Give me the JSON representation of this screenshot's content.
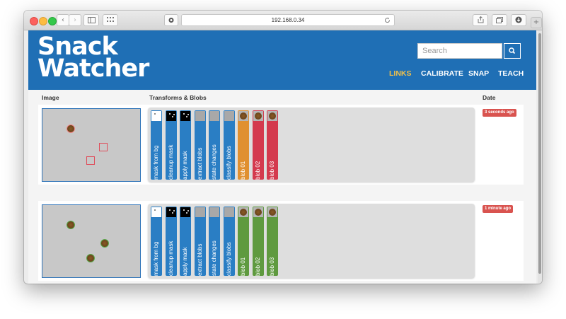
{
  "browser": {
    "url": "192.168.0.34",
    "back_glyph": "‹",
    "forward_glyph": "›"
  },
  "app": {
    "logo_line1": "Snack",
    "logo_line2": "Watcher",
    "search_placeholder": "Search",
    "nav": [
      "LINKS",
      "CALIBRATE",
      "SNAP",
      "TEACH"
    ],
    "active_nav": "LINKS"
  },
  "table": {
    "headers": {
      "image": "Image",
      "transforms": "Transforms & Blobs",
      "date": "Date"
    }
  },
  "rows": [
    {
      "date": "3 seconds ago",
      "strips": [
        {
          "label": "mask from bg",
          "color": "#2a7ec4",
          "thumb": "white"
        },
        {
          "label": "cleanup mask",
          "color": "#2a7ec4",
          "thumb": "black"
        },
        {
          "label": "apply mask",
          "color": "#2a7ec4",
          "thumb": "black"
        },
        {
          "label": "extract blobs",
          "color": "#2a7ec4",
          "thumb": "gray"
        },
        {
          "label": "state changes",
          "color": "#2a7ec4",
          "thumb": "gray"
        },
        {
          "label": "classify blobs",
          "color": "#2a7ec4",
          "thumb": "gray"
        },
        {
          "label": "blob 01",
          "color": "#e09030",
          "thumb": "blob"
        },
        {
          "label": "blob 02",
          "color": "#d43a4e",
          "thumb": "blob"
        },
        {
          "label": "blob 03",
          "color": "#d43a4e",
          "thumb": "blob"
        }
      ]
    },
    {
      "date": "1 minute ago",
      "strips": [
        {
          "label": "mask from bg",
          "color": "#2a7ec4",
          "thumb": "white"
        },
        {
          "label": "cleanup mask",
          "color": "#2a7ec4",
          "thumb": "black"
        },
        {
          "label": "apply mask",
          "color": "#2a7ec4",
          "thumb": "black"
        },
        {
          "label": "extract blobs",
          "color": "#2a7ec4",
          "thumb": "gray"
        },
        {
          "label": "state changes",
          "color": "#2a7ec4",
          "thumb": "gray"
        },
        {
          "label": "classify blobs",
          "color": "#2a7ec4",
          "thumb": "gray"
        },
        {
          "label": "blob 01",
          "color": "#5f9a3f",
          "thumb": "blob"
        },
        {
          "label": "blob 02",
          "color": "#5f9a3f",
          "thumb": "blob"
        },
        {
          "label": "blob 03",
          "color": "#5f9a3f",
          "thumb": "blob"
        }
      ]
    }
  ]
}
